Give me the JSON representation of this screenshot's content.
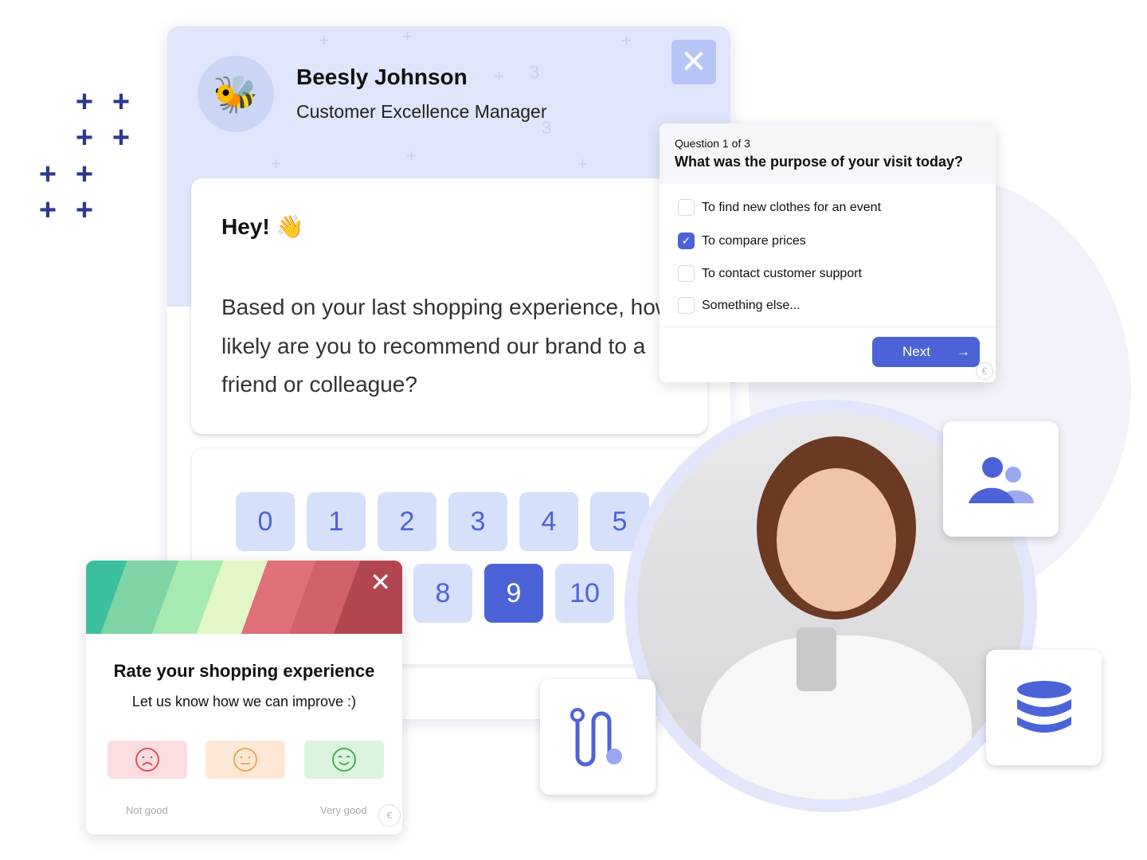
{
  "agent": {
    "name": "Beesly Johnson",
    "title": "Customer Excellence Manager"
  },
  "message": {
    "greeting": "Hey! 👋",
    "line1": "Based on your last shopping experience, how",
    "line2": "likely are you to recommend our brand to a",
    "line3": "friend or colleague?"
  },
  "nps": {
    "scores": [
      "0",
      "1",
      "2",
      "3",
      "4",
      "5",
      "8",
      "9",
      "10"
    ],
    "selected": "9"
  },
  "question": {
    "counter": "Question 1 of 3",
    "title": "What was the purpose of your visit today?",
    "options": [
      {
        "label": "To find new clothes for an event",
        "checked": false
      },
      {
        "label": "To compare prices",
        "checked": true
      },
      {
        "label": "To contact customer support",
        "checked": false
      },
      {
        "label": "Something else...",
        "checked": false
      }
    ],
    "next_label": "Next"
  },
  "rating": {
    "title": "Rate your shopping experience",
    "subtitle": "Let us know how we can improve :)",
    "low_label": "Not good",
    "high_label": "Very good"
  },
  "colors": {
    "accent": "#4c63d8",
    "navy": "#2b3a8f",
    "header": "#dfe6fb"
  }
}
